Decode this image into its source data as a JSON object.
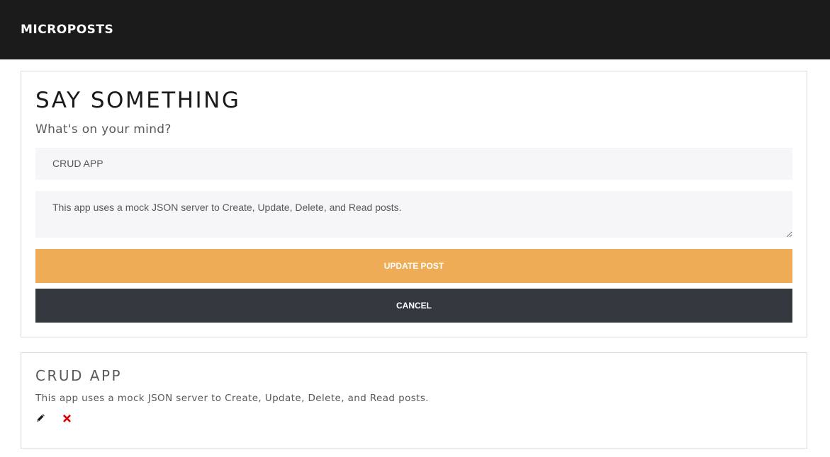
{
  "navbar": {
    "brand": "MICROPOSTS"
  },
  "form": {
    "heading": "SAY SOMETHING",
    "subheading": "What's on your mind?",
    "title_value": "CRUD APP",
    "body_value": "This app uses a mock JSON server to Create, Update, Delete, and Read posts.",
    "update_label": "UPDATE POST",
    "cancel_label": "CANCEL"
  },
  "posts": [
    {
      "title": "CRUD APP",
      "body": "This app uses a mock JSON server to Create, Update, Delete, and Read posts.",
      "edit_icon": "pencil-icon",
      "delete_icon": "close-icon"
    }
  ],
  "colors": {
    "navbar_bg": "#1b1b1b",
    "update_button": "#eeac57",
    "cancel_button": "#33373e",
    "delete_icon": "#e00000",
    "input_bg": "#f6f6f8"
  }
}
